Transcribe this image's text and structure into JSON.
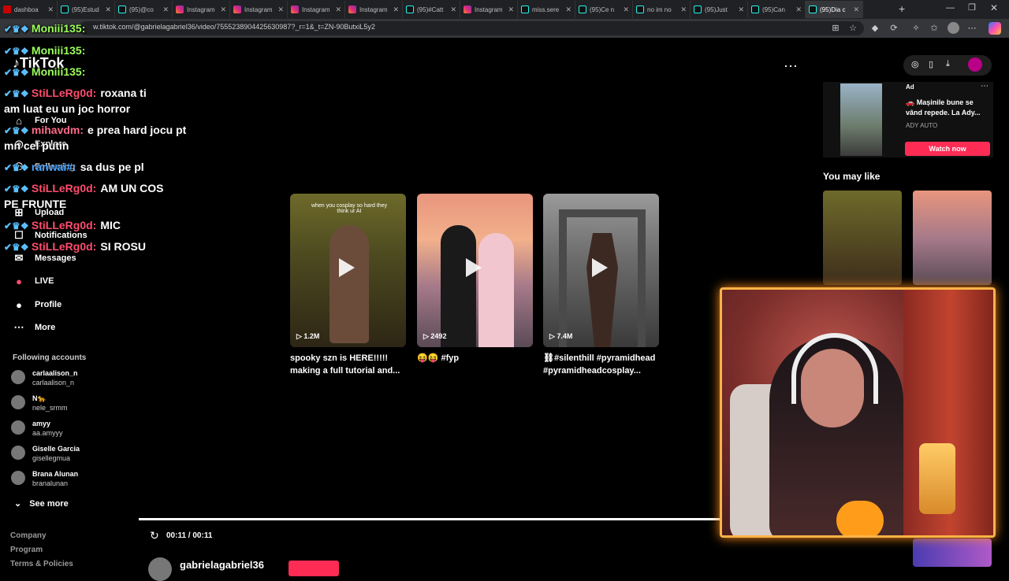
{
  "browser": {
    "tabs": [
      {
        "label": "dashboa",
        "icon": "yt"
      },
      {
        "label": "(95)Estud",
        "icon": "tt"
      },
      {
        "label": "(95)@co",
        "icon": "tt"
      },
      {
        "label": "Instagram",
        "icon": "ig"
      },
      {
        "label": "Instagram",
        "icon": "ig"
      },
      {
        "label": "Instagram",
        "icon": "ig"
      },
      {
        "label": "Instagram",
        "icon": "ig"
      },
      {
        "label": "(95)#Catt",
        "icon": "tt"
      },
      {
        "label": "Instagram",
        "icon": "ig"
      },
      {
        "label": "miss.sere",
        "icon": "tt"
      },
      {
        "label": "(95)Ce n",
        "icon": "tt"
      },
      {
        "label": "no im no",
        "icon": "tt"
      },
      {
        "label": "(95)Just",
        "icon": "tt"
      },
      {
        "label": "(95)Can",
        "icon": "tt"
      },
      {
        "label": "(95)Dia c",
        "icon": "tt"
      }
    ],
    "url": "w.tiktok.com/@gabrielagabriel36/video/7555238904425630987?_r=1&_t=ZN-90ButxiL5y2"
  },
  "tiktok": {
    "logo": "TikTok",
    "nav": [
      {
        "label": "For You",
        "icon": "home-icon"
      },
      {
        "label": "Explore",
        "icon": "compass-icon"
      },
      {
        "label": "Following",
        "icon": "people-icon"
      },
      {
        "label": "Upload",
        "icon": "upload-icon"
      },
      {
        "label": "Notifications",
        "icon": "bell-icon"
      },
      {
        "label": "Messages",
        "icon": "message-icon"
      },
      {
        "label": "LIVE",
        "icon": "live-icon"
      },
      {
        "label": "Profile",
        "icon": "avatar"
      },
      {
        "label": "More",
        "icon": "more-icon"
      }
    ],
    "following_title": "Following accounts",
    "following": [
      {
        "name": "carlaalison_n",
        "handle": "carlaalison_n"
      },
      {
        "name": "N🐆",
        "handle": "nele_srmm"
      },
      {
        "name": "amyy",
        "handle": "aa.amyyy"
      },
      {
        "name": "Giselle Garcia",
        "handle": "gisellegmua"
      },
      {
        "name": "Brana Alunan",
        "handle": "branalunan"
      }
    ],
    "see_more": "See more",
    "footer": [
      "Company",
      "Program",
      "Terms & Policies"
    ],
    "videos": [
      {
        "views": "1.2M",
        "caption": "spooky szn is HERE!!!!! making a full tutorial and...",
        "overlay": "when you cosplay so hard they think ur AI"
      },
      {
        "views": "2492",
        "caption": "😝😝 #fyp",
        "overlay": ""
      },
      {
        "views": "7.4M",
        "caption": "⛓#silenthill #pyramidhead #pyramidheadcosplay...",
        "overlay": ""
      }
    ],
    "time": "00:11 / 00:11",
    "creator": "gabrielagabriel36",
    "ad": {
      "tag": "Ad",
      "text": "🚗 Mașinile bune se vând repede. La Ady...",
      "brand": "ADY AUTO",
      "cta": "Watch now"
    },
    "you_may_like": "You may like"
  },
  "chat": [
    {
      "user": "Moniii135:",
      "text": ""
    },
    {
      "user": "Moniii135:",
      "text": ""
    },
    {
      "user": "Moniii135:",
      "text": ""
    },
    {
      "user": "StiLLeRg0d:",
      "text": "roxana ti"
    },
    {
      "cont": "am luat eu un joc horror"
    },
    {
      "user": "mihavdm:",
      "text": "e prea hard jocu pt"
    },
    {
      "cont": "mn cel putin"
    },
    {
      "user": "ranwai#:",
      "text": "sa dus pe pl"
    },
    {
      "user": "StiLLeRg0d:",
      "text": "AM UN COS"
    },
    {
      "cont": "PE FRUNTE"
    },
    {
      "user": "StiLLeRg0d:",
      "text": "MIC"
    },
    {
      "user": "StiLLeRg0d:",
      "text": "SI ROSU"
    }
  ],
  "colors": {
    "accent": "#fe2c55",
    "webcam_border": "#ffb347"
  }
}
